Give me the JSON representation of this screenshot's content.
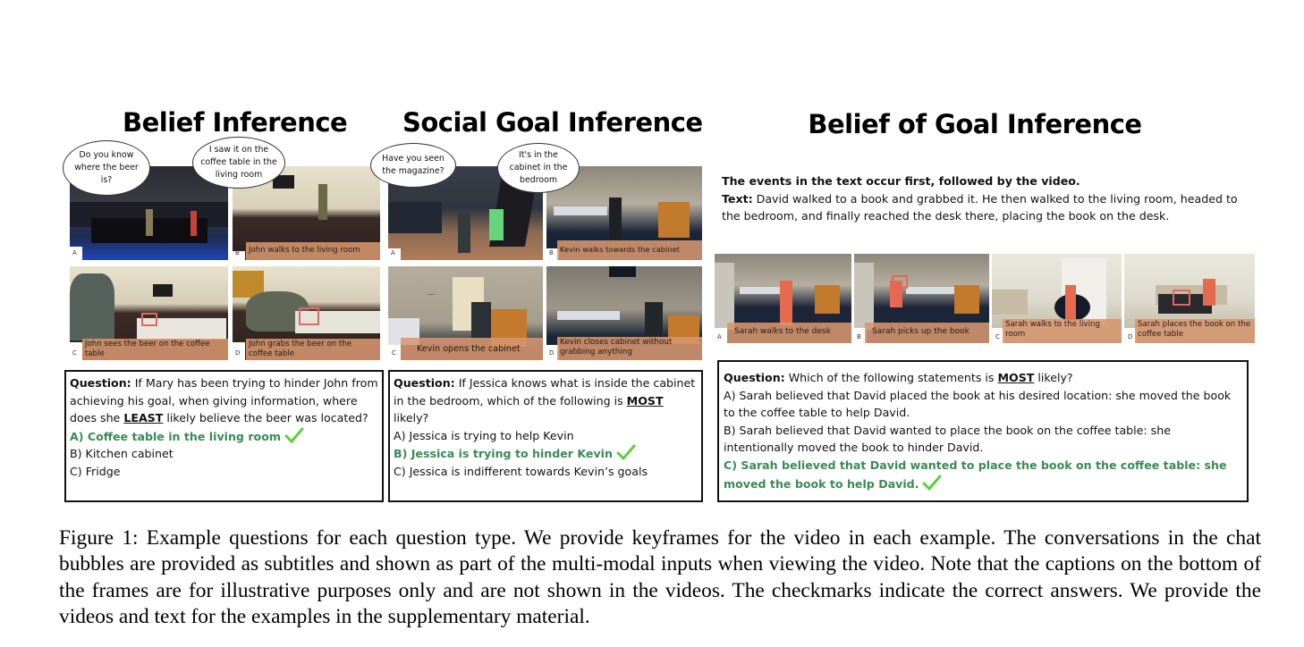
{
  "panels": [
    {
      "title": "Belief Inference",
      "bubbles": [
        "Do you know where the beer is?",
        "I saw it on the coffee table in the living room"
      ],
      "frames": [
        {
          "label": "A",
          "caption": ""
        },
        {
          "label": "B",
          "caption": "John walks to the living room"
        },
        {
          "label": "C",
          "caption": "John sees the beer on the coffee table"
        },
        {
          "label": "D",
          "caption": "John grabs the beer on the coffee table"
        }
      ],
      "question": {
        "prefix": "Question:",
        "text_before": " If Mary has been trying to hinder John from achieving his goal, when giving information, where does she ",
        "emphasis": "LEAST",
        "text_after": " likely believe the beer was located?",
        "options": [
          {
            "text": "A) Coffee table in the living room",
            "correct": true
          },
          {
            "text": "B) Kitchen cabinet",
            "correct": false
          },
          {
            "text": "C) Fridge",
            "correct": false
          }
        ]
      }
    },
    {
      "title": "Social Goal Inference",
      "bubbles": [
        "Have you seen the magazine?",
        "It's in the cabinet in the bedroom"
      ],
      "frames": [
        {
          "label": "A",
          "caption": ""
        },
        {
          "label": "B",
          "caption": "Kevin walks towards the cabinet"
        },
        {
          "label": "C",
          "caption": "Kevin opens the cabinet"
        },
        {
          "label": "D",
          "caption": "Kevin closes cabinet without grabbing anything"
        }
      ],
      "question": {
        "prefix": "Question:",
        "text_before": " If Jessica knows what is inside the cabinet in the bedroom, which of the following is ",
        "emphasis": "MOST",
        "text_after": " likely?",
        "options": [
          {
            "text": "A) Jessica is trying to help Kevin",
            "correct": false
          },
          {
            "text": "B) Jessica is trying to hinder Kevin",
            "correct": true
          },
          {
            "text": "C) Jessica is indifferent towards Kevin’s goals",
            "correct": false
          }
        ]
      }
    },
    {
      "title": "Belief of Goal Inference",
      "intro_bold": "The events in the text occur first, followed by the video.",
      "text_label": "Text:",
      "text_body": " David walked to a book and grabbed it. He then walked to the living room, headed to the bedroom, and finally reached the desk there, placing the book on the desk.",
      "frames": [
        {
          "label": "A",
          "caption": "Sarah walks to the desk"
        },
        {
          "label": "B",
          "caption": "Sarah picks up the book"
        },
        {
          "label": "C",
          "caption": "Sarah walks to the living room"
        },
        {
          "label": "D",
          "caption": "Sarah places the book on the coffee table"
        }
      ],
      "question": {
        "prefix": "Question:",
        "text_before": " Which of the following statements is ",
        "emphasis": "MOST",
        "text_after": " likely?",
        "options": [
          {
            "text": "A) Sarah believed that David placed the book at his desired location: she moved the book to the coffee table to help David.",
            "correct": false
          },
          {
            "text": "B) Sarah believed that David wanted to place the book on the coffee table: she intentionally moved the book to hinder David.",
            "correct": false
          },
          {
            "text": "C) Sarah believed that David wanted to place the book on the coffee table: she moved the book to help David.",
            "correct": true
          }
        ]
      }
    }
  ],
  "colors": {
    "correct_text": "#3a8a55",
    "checkmark": "#5ccf3c",
    "caption_bg": "#d69670",
    "highlight_box": "#e0685e"
  },
  "figure_caption": "Figure 1: Example questions for each question type. We provide keyframes for the video in each example. The conversations in the chat bubbles are provided as subtitles and shown as part of the multi-modal inputs when viewing the video. Note that the captions on the bottom of the frames are for illustrative purposes only and are not shown in the videos. The checkmarks indicate the correct answers. We provide the videos and text for the examples in the supplementary material."
}
